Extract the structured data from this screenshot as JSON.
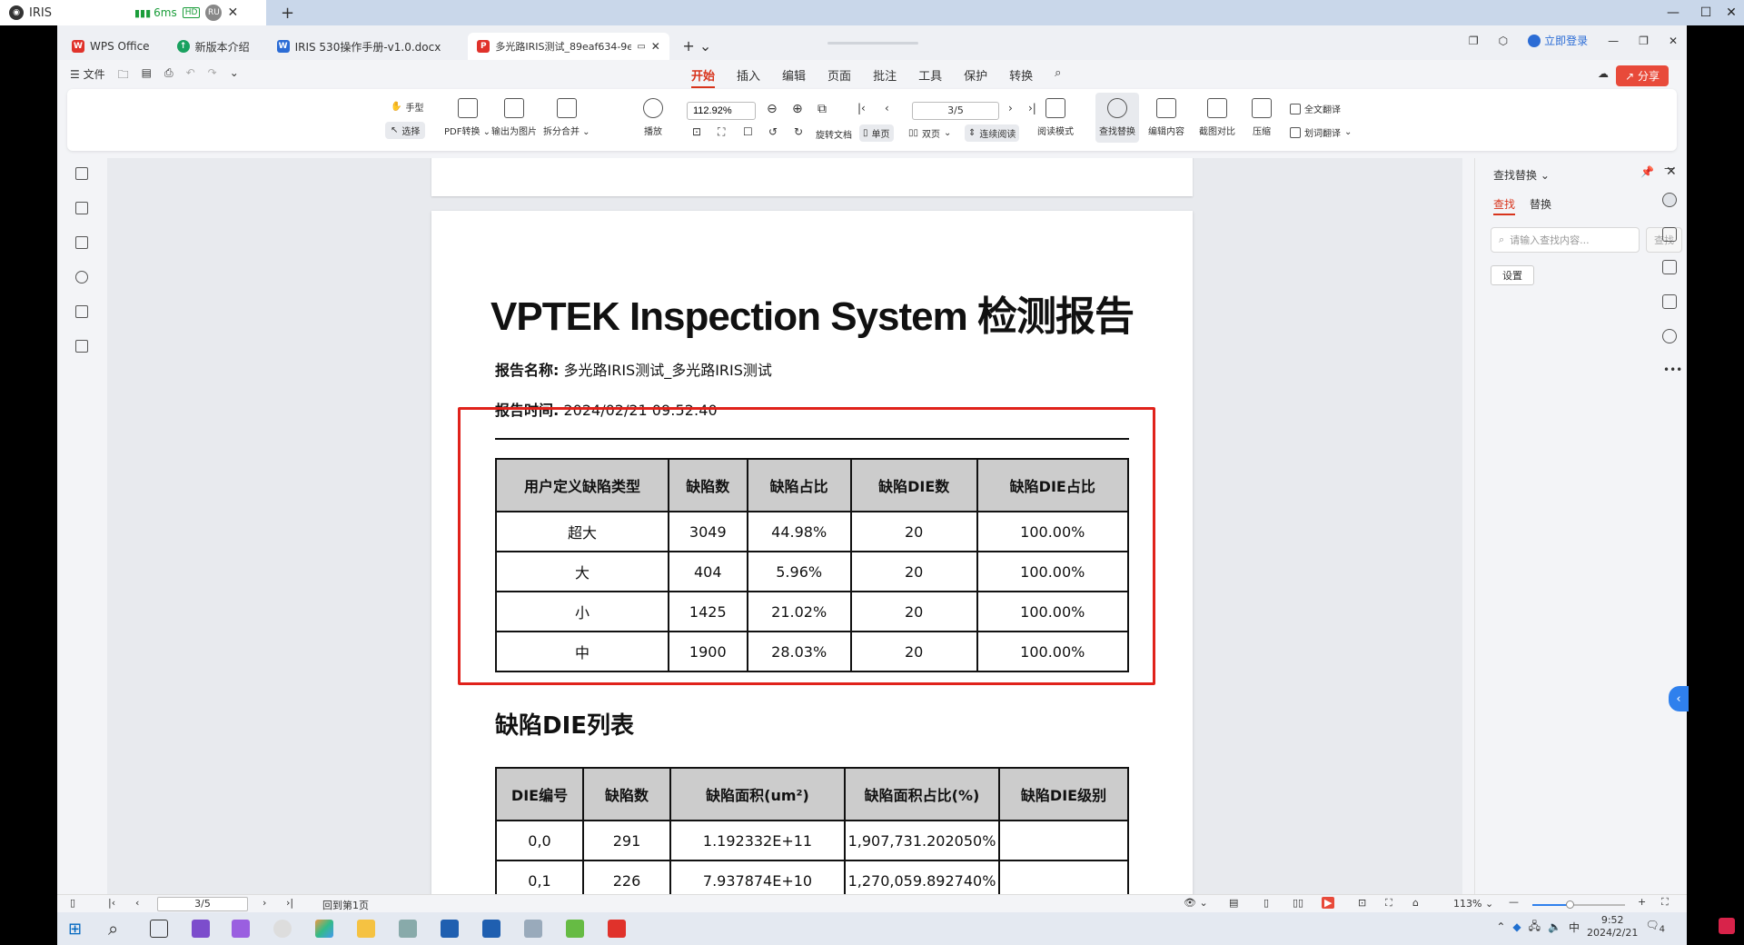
{
  "remote": {
    "tab_title": "IRIS",
    "ping": "6ms",
    "hd_badge": "HD",
    "user_badge": "RU",
    "new_tab": "+"
  },
  "wps": {
    "tabs": [
      {
        "label": "WPS Office",
        "color": "#e0322b",
        "glyph": "W"
      },
      {
        "label": "新版本介绍",
        "color": "#19a15f",
        "glyph": "↑"
      },
      {
        "label": "IRIS 530操作手册-v1.0.docx",
        "color": "#2b6cd5",
        "glyph": "W"
      },
      {
        "label": "多光路IRIS测试_89eaf634-9e",
        "color": "#e0322b",
        "glyph": "P"
      }
    ],
    "login": "立即登录",
    "share": "分享",
    "menu_left": {
      "file": "文件"
    },
    "ribbon_tabs": [
      "开始",
      "插入",
      "编辑",
      "页面",
      "批注",
      "工具",
      "保护",
      "转换"
    ]
  },
  "toolbar": {
    "hand": "手型",
    "select": "选择",
    "pdf_convert": "PDF转换",
    "export_image": "输出为图片",
    "split_merge": "拆分合并",
    "play": "播放",
    "zoom": "112.92%",
    "page": "3/5",
    "rotate": "旋转文档",
    "single": "单页",
    "double": "双页",
    "continuous": "连续阅读",
    "read_mode": "阅读模式",
    "find_replace": "查找替换",
    "edit_content": "编辑内容",
    "screenshot_compare": "截图对比",
    "compress": "压缩",
    "full_translate": "全文翻译",
    "word_translate": "划词翻译"
  },
  "document": {
    "title": "VPTEK Inspection System 检测报告",
    "report_name_label": "报告名称:",
    "report_name_value": "多光路IRIS测试_多光路IRIS测试",
    "report_time_label": "报告时间:",
    "report_time_value": "2024/02/21 09:52:40",
    "table1": {
      "headers": [
        "用户定义缺陷类型",
        "缺陷数",
        "缺陷占比",
        "缺陷DIE数",
        "缺陷DIE占比"
      ],
      "rows": [
        [
          "超大",
          "3049",
          "44.98%",
          "20",
          "100.00%"
        ],
        [
          "大",
          "404",
          "5.96%",
          "20",
          "100.00%"
        ],
        [
          "小",
          "1425",
          "21.02%",
          "20",
          "100.00%"
        ],
        [
          "中",
          "1900",
          "28.03%",
          "20",
          "100.00%"
        ]
      ]
    },
    "section_title": "缺陷DIE列表",
    "table2": {
      "headers": [
        "DIE编号",
        "缺陷数",
        "缺陷面积(um²)",
        "缺陷面积占比(%)",
        "缺陷DIE级别"
      ],
      "rows": [
        [
          "0,0",
          "291",
          "1.192332E+11",
          "1,907,731.202050%",
          ""
        ],
        [
          "0,1",
          "226",
          "7.937874E+10",
          "1,270,059.892740%",
          ""
        ]
      ]
    },
    "highlight_color": "#e0221b"
  },
  "find_panel": {
    "title": "查找替换",
    "tab_find": "查找",
    "tab_replace": "替换",
    "placeholder": "请输入查找内容...",
    "find_btn": "查找",
    "settings_btn": "设置"
  },
  "status": {
    "page": "3/5",
    "back_to_first": "回到第1页",
    "zoom": "113%",
    "zoom_fraction": 0.4
  },
  "taskbar": {
    "time": "9:52",
    "date": "2024/2/21",
    "ime": "中",
    "notification_count": "4"
  }
}
